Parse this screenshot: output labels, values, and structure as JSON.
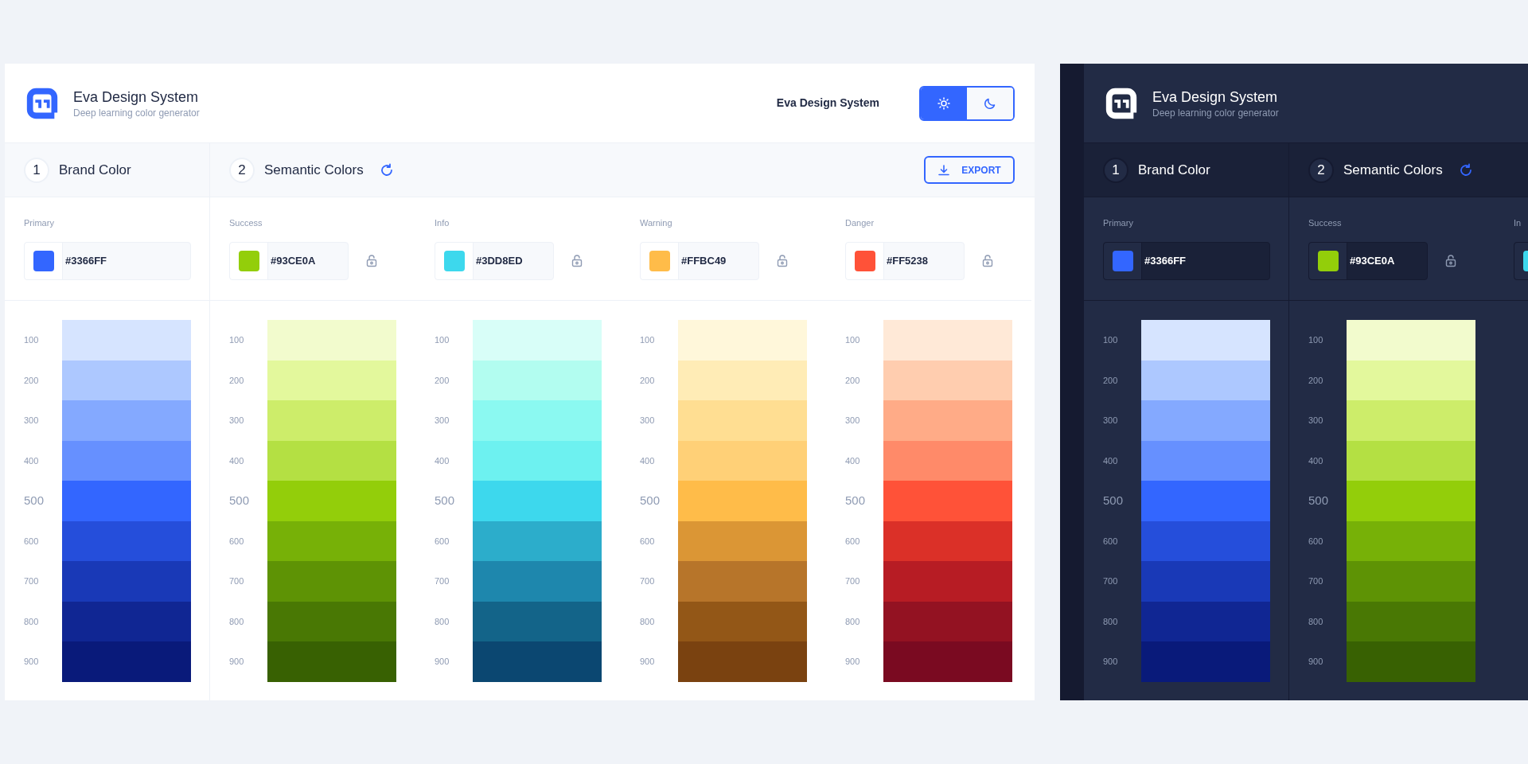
{
  "panels": [
    {
      "kind": "light",
      "title": "Eva Design System",
      "subtitle": "Deep learning color generator",
      "nav_text": "Eva Design System",
      "theme_toggle": [
        {
          "kind": "light",
          "selected": true
        },
        {
          "kind": "dark",
          "selected": false
        }
      ],
      "steps": [
        {
          "number": "1",
          "title": "Brand Color"
        },
        {
          "number": "2",
          "title": "Semantic Colors",
          "refresh": true
        }
      ],
      "export_button": "EXPORT",
      "columns": [
        {
          "label": "Primary",
          "hex": "#3366FF",
          "color": "#3366ff",
          "kind": "brand",
          "shades": [
            {
              "label": "100",
              "color": "#d6e4ff",
              "base": false
            },
            {
              "label": "200",
              "color": "#adc8ff",
              "base": false
            },
            {
              "label": "300",
              "color": "#84a9ff",
              "base": false
            },
            {
              "label": "400",
              "color": "#6690ff",
              "base": false
            },
            {
              "label": "500",
              "color": "#3366ff",
              "base": true
            },
            {
              "label": "600",
              "color": "#254edb",
              "base": false
            },
            {
              "label": "700",
              "color": "#1939b7",
              "base": false
            },
            {
              "label": "800",
              "color": "#102693",
              "base": false
            },
            {
              "label": "900",
              "color": "#091a7a",
              "base": false
            }
          ]
        },
        {
          "label": "Success",
          "hex": "#93CE0A",
          "color": "#93ce0a",
          "kind": "semantic",
          "locked": false,
          "shades": [
            {
              "label": "100",
              "color": "#f2fbcd",
              "base": false
            },
            {
              "label": "200",
              "color": "#e3f89c",
              "base": false
            },
            {
              "label": "300",
              "color": "#cded6a",
              "base": false
            },
            {
              "label": "400",
              "color": "#b4e043",
              "base": false
            },
            {
              "label": "500",
              "color": "#93ce0a",
              "base": true
            },
            {
              "label": "600",
              "color": "#77b107",
              "base": false
            },
            {
              "label": "700",
              "color": "#5e9305",
              "base": false
            },
            {
              "label": "800",
              "color": "#497804",
              "base": false
            },
            {
              "label": "900",
              "color": "#386102",
              "base": false
            }
          ]
        },
        {
          "label": "Info",
          "hex": "#3DD8ED",
          "color": "#3dd8ed",
          "kind": "semantic",
          "locked": false,
          "shades": [
            {
              "label": "100",
              "color": "#d8fef8",
              "base": false
            },
            {
              "label": "200",
              "color": "#b2fdf0",
              "base": false
            },
            {
              "label": "300",
              "color": "#8bf9f1",
              "base": false
            },
            {
              "label": "400",
              "color": "#6df1f0",
              "base": false
            },
            {
              "label": "500",
              "color": "#3dd8ed",
              "base": true
            },
            {
              "label": "600",
              "color": "#2cadcb",
              "base": false
            },
            {
              "label": "700",
              "color": "#1e87ad",
              "base": false
            },
            {
              "label": "800",
              "color": "#136489",
              "base": false
            },
            {
              "label": "900",
              "color": "#0b4771",
              "base": false
            }
          ]
        },
        {
          "label": "Warning",
          "hex": "#FFBC49",
          "color": "#ffbc49",
          "kind": "semantic",
          "locked": false,
          "shades": [
            {
              "label": "100",
              "color": "#fff7da",
              "base": false
            },
            {
              "label": "200",
              "color": "#ffecb6",
              "base": false
            },
            {
              "label": "300",
              "color": "#ffde92",
              "base": false
            },
            {
              "label": "400",
              "color": "#ffd077",
              "base": false
            },
            {
              "label": "500",
              "color": "#ffbc49",
              "base": true
            },
            {
              "label": "600",
              "color": "#db9635",
              "base": false
            },
            {
              "label": "700",
              "color": "#b7752a",
              "base": false
            },
            {
              "label": "800",
              "color": "#935717",
              "base": false
            },
            {
              "label": "900",
              "color": "#7a4210",
              "base": false
            }
          ]
        },
        {
          "label": "Danger",
          "hex": "#FF5238",
          "color": "#ff5238",
          "kind": "semantic",
          "locked": false,
          "shades": [
            {
              "label": "100",
              "color": "#ffe9d7",
              "base": false
            },
            {
              "label": "200",
              "color": "#ffcdaf",
              "base": false
            },
            {
              "label": "300",
              "color": "#ffab87",
              "base": false
            },
            {
              "label": "400",
              "color": "#ff8a69",
              "base": false
            },
            {
              "label": "500",
              "color": "#ff5238",
              "base": true
            },
            {
              "label": "600",
              "color": "#db3028",
              "base": false
            },
            {
              "label": "700",
              "color": "#b71c24",
              "base": false
            },
            {
              "label": "800",
              "color": "#931222",
              "base": false
            },
            {
              "label": "900",
              "color": "#7a0a21",
              "base": false
            }
          ]
        }
      ]
    },
    {
      "kind": "dark",
      "title": "Eva Design System",
      "subtitle": "Deep learning color generator",
      "steps": [
        {
          "number": "1",
          "title": "Brand Color"
        },
        {
          "number": "2",
          "title": "Semantic Colors",
          "refresh": true
        }
      ],
      "columns": [
        {
          "label": "Primary",
          "hex": "#3366FF",
          "color": "#3366ff",
          "kind": "brand",
          "shades": [
            {
              "label": "100",
              "color": "#d6e4ff",
              "base": false
            },
            {
              "label": "200",
              "color": "#adc8ff",
              "base": false
            },
            {
              "label": "300",
              "color": "#84a9ff",
              "base": false
            },
            {
              "label": "400",
              "color": "#6690ff",
              "base": false
            },
            {
              "label": "500",
              "color": "#3366ff",
              "base": true
            },
            {
              "label": "600",
              "color": "#254edb",
              "base": false
            },
            {
              "label": "700",
              "color": "#1939b7",
              "base": false
            },
            {
              "label": "800",
              "color": "#102693",
              "base": false
            },
            {
              "label": "900",
              "color": "#091a7a",
              "base": false
            }
          ]
        },
        {
          "label": "Success",
          "hex": "#93CE0A",
          "color": "#93ce0a",
          "kind": "semantic",
          "locked": false,
          "shades": [
            {
              "label": "100",
              "color": "#f2fbcd",
              "base": false
            },
            {
              "label": "200",
              "color": "#e3f89c",
              "base": false
            },
            {
              "label": "300",
              "color": "#cded6a",
              "base": false
            },
            {
              "label": "400",
              "color": "#b4e043",
              "base": false
            },
            {
              "label": "500",
              "color": "#93ce0a",
              "base": true
            },
            {
              "label": "600",
              "color": "#77b107",
              "base": false
            },
            {
              "label": "700",
              "color": "#5e9305",
              "base": false
            },
            {
              "label": "800",
              "color": "#497804",
              "base": false
            },
            {
              "label": "900",
              "color": "#386102",
              "base": false
            }
          ]
        },
        {
          "label": "In",
          "color": "#3dd8ed",
          "kind": "semantic"
        }
      ]
    }
  ]
}
